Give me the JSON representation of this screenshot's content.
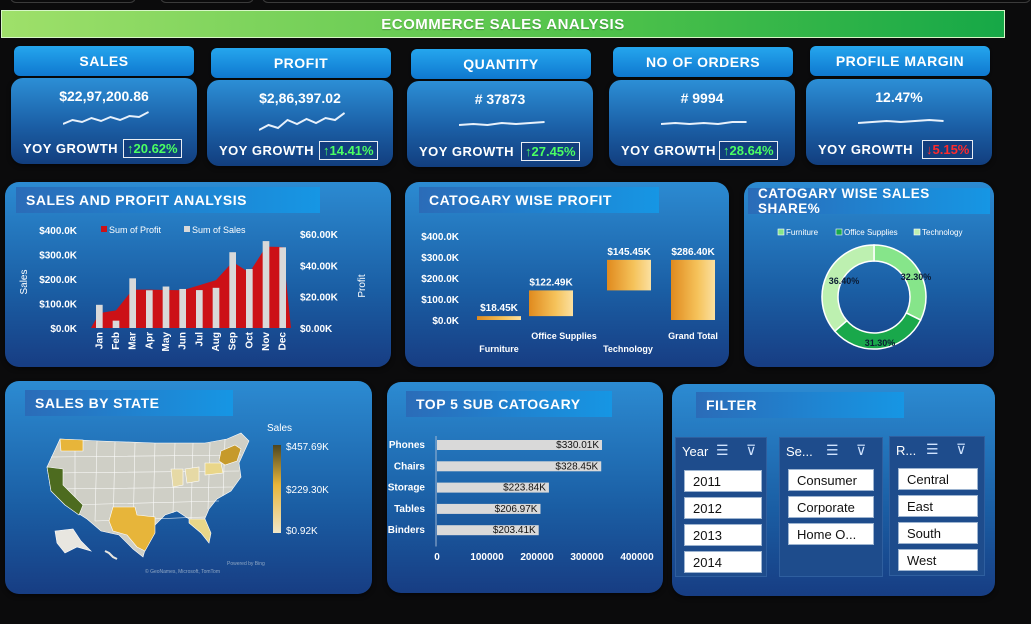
{
  "title": "ECOMMERCE SALES ANALYSIS",
  "kpis": [
    {
      "label": "SALES",
      "value": "$22,97,200.86",
      "yoy_label": "YOY GROWTH",
      "yoy": "20.62%",
      "arrow": "↑",
      "dir": "up"
    },
    {
      "label": "PROFIT",
      "value": "$2,86,397.02",
      "yoy_label": "YOY GROWTH",
      "yoy": "14.41%",
      "arrow": "↑",
      "dir": "up"
    },
    {
      "label": "QUANTITY",
      "value": "# 37873",
      "yoy_label": "YOY GROWTH",
      "yoy": "27.45%",
      "arrow": "↑",
      "dir": "up"
    },
    {
      "label": "NO OF ORDERS",
      "value": "# 9994",
      "yoy_label": "YOY GROWTH",
      "yoy": "28.64%",
      "arrow": "↑",
      "dir": "up"
    },
    {
      "label": "PROFILE MARGIN",
      "value": "12.47%",
      "yoy_label": "YOY GROWTH",
      "yoy": "5.15%",
      "arrow": "↓",
      "dir": "down"
    }
  ],
  "panels": {
    "sales_profit": {
      "title": "SALES AND PROFIT ANALYSIS"
    },
    "category_profit": {
      "title": "CATOGARY WISE PROFIT"
    },
    "category_share": {
      "title": "CATOGARY WISE SALES SHARE%"
    },
    "by_state": {
      "title": "SALES BY STATE",
      "legend_title": "Sales",
      "legend_max": "$457.69K",
      "legend_mid": "$229.30K",
      "legend_min": "$0.92K",
      "credit1": "Powered by Bing",
      "credit2": "© GeoNames, Microsoft, TomTom"
    },
    "top5": {
      "title": "TOP 5 SUB CATOGARY"
    },
    "filter": {
      "title": "FILTER"
    }
  },
  "colors": {
    "profit": "#cc1116",
    "sales": "#d9d9d9",
    "accent_green": "#4aff63",
    "down_red": "#ff2a2a",
    "map_high": "#4d6b1f",
    "map_low": "#e8e2c8",
    "map_mid": "#e7b53a"
  },
  "chart_data": [
    {
      "type": "area",
      "title": "SALES AND PROFIT ANALYSIS",
      "categories": [
        "Jan",
        "Feb",
        "Mar",
        "Apr",
        "May",
        "Jun",
        "Jul",
        "Aug",
        "Sep",
        "Oct",
        "Nov",
        "Dec"
      ],
      "series": [
        {
          "name": "Sum of Profit",
          "axis": "left",
          "values": [
            9.1,
            10.8,
            23.5,
            23.5,
            23.3,
            23.1,
            26.2,
            29.3,
            40.5,
            33.9,
            49.8,
            49.6
          ]
        },
        {
          "name": "Sum of Sales",
          "axis": "right",
          "values": [
            14.2,
            4.5,
            30.4,
            23.1,
            25.4,
            23.9,
            23.2,
            24.6,
            46.4,
            36.1,
            53.2,
            49.4
          ]
        }
      ],
      "ylabel": "Sales",
      "y2label": "Profit",
      "y_ticks": [
        "$400.0K",
        "$300.0K",
        "$200.0K",
        "$100.0K",
        "$0.0K"
      ],
      "y2_ticks": [
        "$60.00K",
        "$40.00K",
        "$20.00K",
        "$0.00K"
      ],
      "ylim": [
        0,
        400
      ],
      "y2lim": [
        0,
        60
      ],
      "legend": "top"
    },
    {
      "type": "bar",
      "subtype": "waterfall",
      "title": "CATOGARY WISE PROFIT",
      "categories": [
        "Furniture",
        "Office Supplies",
        "Technology",
        "Grand Total"
      ],
      "values": [
        18.45,
        122.49,
        145.45,
        286.4
      ],
      "labels": [
        "$18.45K",
        "$122.49K",
        "$145.45K",
        "$286.40K"
      ],
      "y_ticks": [
        "$400.0K",
        "$300.0K",
        "$200.0K",
        "$100.0K",
        "$0.0K"
      ],
      "ylim": [
        0,
        400
      ]
    },
    {
      "type": "pie",
      "subtype": "donut",
      "title": "CATOGARY WISE SALES SHARE%",
      "categories": [
        "Furniture",
        "Office Supplies",
        "Technology"
      ],
      "values": [
        32.3,
        31.3,
        36.4
      ],
      "labels": [
        "32.30%",
        "31.30%",
        "36.40%"
      ],
      "colors": [
        "#86e58a",
        "#19a84b",
        "#bdf0b0"
      ],
      "legend": "top"
    },
    {
      "type": "bar",
      "orientation": "horizontal",
      "title": "TOP 5 SUB CATOGARY",
      "categories": [
        "Phones",
        "Chairs",
        "Storage",
        "Tables",
        "Binders"
      ],
      "values": [
        330010,
        328450,
        223840,
        206970,
        203410
      ],
      "labels": [
        "$330.01K",
        "$328.45K",
        "$223.84K",
        "$206.97K",
        "$203.41K"
      ],
      "x_ticks": [
        "0",
        "100000",
        "200000",
        "300000",
        "400000"
      ],
      "xlim": [
        0,
        400000
      ]
    }
  ],
  "filters": [
    {
      "label": "Year",
      "items": [
        "2011",
        "2012",
        "2013",
        "2014"
      ]
    },
    {
      "label": "Se...",
      "items": [
        "Consumer",
        "Corporate",
        "Home O..."
      ]
    },
    {
      "label": "R...",
      "items": [
        "Central",
        "East",
        "South",
        "West"
      ]
    }
  ],
  "spark_icons": [
    "multi-select-icon",
    "clear-filter-icon"
  ]
}
